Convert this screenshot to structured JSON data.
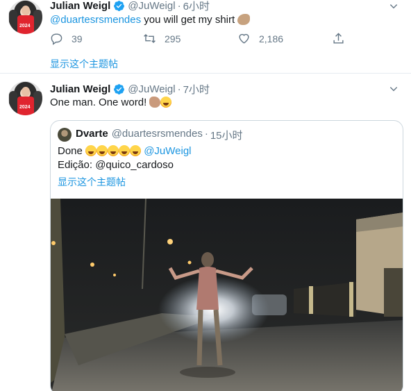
{
  "tweets": [
    {
      "author_name": "Julian Weigl",
      "handle": "@JuWeigl",
      "separator": "·",
      "time": "6小时",
      "avatar_jersey_text": "2024",
      "text_mention": "@duartesrsmendes",
      "text_body": " you will get my shirt",
      "text_emoji": "flexed-biceps-emoji",
      "actions": {
        "reply_count": "39",
        "retweet_count": "295",
        "like_count": "2,186"
      },
      "show_thread_label": "显示这个主题帖"
    },
    {
      "author_name": "Julian Weigl",
      "handle": "@JuWeigl",
      "separator": "·",
      "time": "7小时",
      "avatar_jersey_text": "2024",
      "text_body": "One man. One word!",
      "text_emojis": [
        "clapping-hands-emoji",
        "laughing-tears-emoji"
      ],
      "quote": {
        "author_name": "Dvarte",
        "handle": "@duartesrsmendes",
        "separator": "·",
        "time": "15小时",
        "line1_prefix": "Done",
        "line1_emojis": [
          "laughing-tears-emoji",
          "laughing-tears-emoji",
          "laughing-tears-emoji",
          "laughing-tears-emoji",
          "laughing-tears-emoji"
        ],
        "line1_mention": "@JuWeigl",
        "line2_prefix": "Edição: ",
        "line2_mention": "@quico_cardoso",
        "show_thread_label": "显示这个主题帖",
        "media": "night-street-video-thumbnail"
      }
    }
  ],
  "colors": {
    "link": "#1b95e0",
    "secondary_text": "#657786",
    "border": "#ccd6dd",
    "verified": "#1da1f2"
  }
}
